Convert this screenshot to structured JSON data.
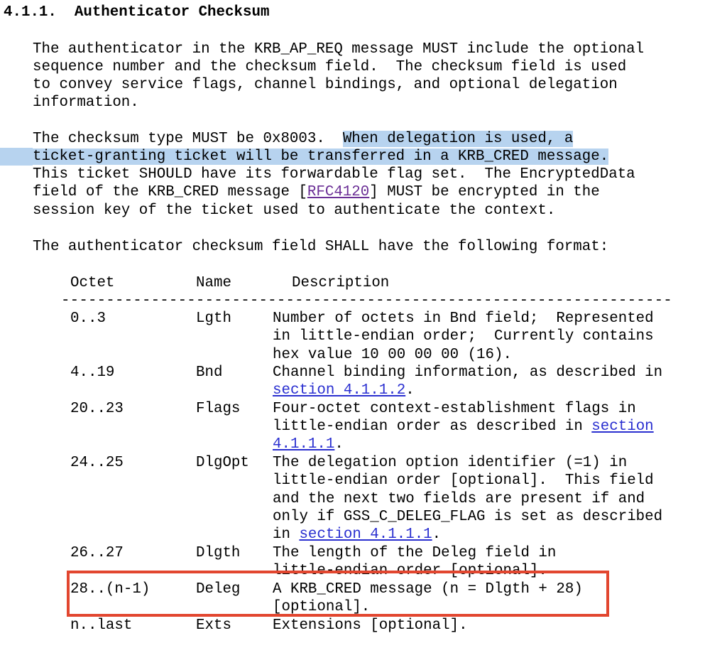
{
  "section": {
    "number": "4.1.1.",
    "title": "Authenticator Checksum"
  },
  "para1": [
    "The authenticator in the KRB_AP_REQ message MUST include the optional",
    "sequence number and the checksum field.  The checksum field is used",
    "to convey service flags, channel bindings, and optional delegation",
    "information."
  ],
  "para2": {
    "l1_pre": "The checksum type MUST be 0x8003.  ",
    "l1_sel": "When delegation is used, a",
    "l2_sel": "ticket-granting ticket will be transferred in a KRB_CRED message.",
    "l3": "This ticket SHOULD have its forwardable flag set.  The EncryptedData",
    "l4_pre": "field of the KRB_CRED message [",
    "l4_link": "RFC4120",
    "l4_post": "] MUST be encrypted in the",
    "l5": "session key of the ticket used to authenticate the context."
  },
  "para3": "The authenticator checksum field SHALL have the following format:",
  "table": {
    "headers": {
      "octet": "Octet",
      "name": "Name",
      "description": "Description"
    },
    "rule": "--------------------------------------------------------------------",
    "rows": [
      {
        "octet": "0..3",
        "name": "Lgth",
        "desc": [
          "Number of octets in Bnd field;  Represented",
          "in little-endian order;  Currently contains",
          "hex value 10 00 00 00 (16)."
        ]
      },
      {
        "octet": "4..19",
        "name": "Bnd",
        "desc": [
          "Channel binding information, as described in"
        ],
        "link_line": {
          "link": "section 4.1.1.2",
          "post": "."
        }
      },
      {
        "octet": "20..23",
        "name": "Flags",
        "desc": [
          "Four-octet context-establishment flags in"
        ],
        "l2_pre": "little-endian order as described in ",
        "l2_link": "section",
        "l3_link": "4.1.1.1",
        "l3_post": "."
      },
      {
        "octet": "24..25",
        "name": "DlgOpt",
        "desc": [
          "The delegation option identifier (=1) in",
          "little-endian order [optional].  This field",
          "and the next two fields are present if and",
          "only if GSS_C_DELEG_FLAG is set as described"
        ],
        "l5_pre": "in ",
        "l5_link": "section 4.1.1.1",
        "l5_post": "."
      },
      {
        "octet": "26..27",
        "name": "Dlgth",
        "desc": [
          "The length of the Deleg field in",
          "little-endian order [optional]."
        ]
      },
      {
        "octet": "28..(n-1)",
        "name": "Deleg",
        "desc": [
          "A KRB_CRED message (n = Dlgth + 28)",
          "[optional]."
        ]
      },
      {
        "octet": "n..last",
        "name": "Exts",
        "desc": [
          "Extensions [optional]."
        ]
      }
    ]
  },
  "colors": {
    "highlight": "#b7d3ef",
    "link": "#2a2fd0",
    "visited_link": "#6b2f96",
    "callout_border": "#e2462f"
  }
}
